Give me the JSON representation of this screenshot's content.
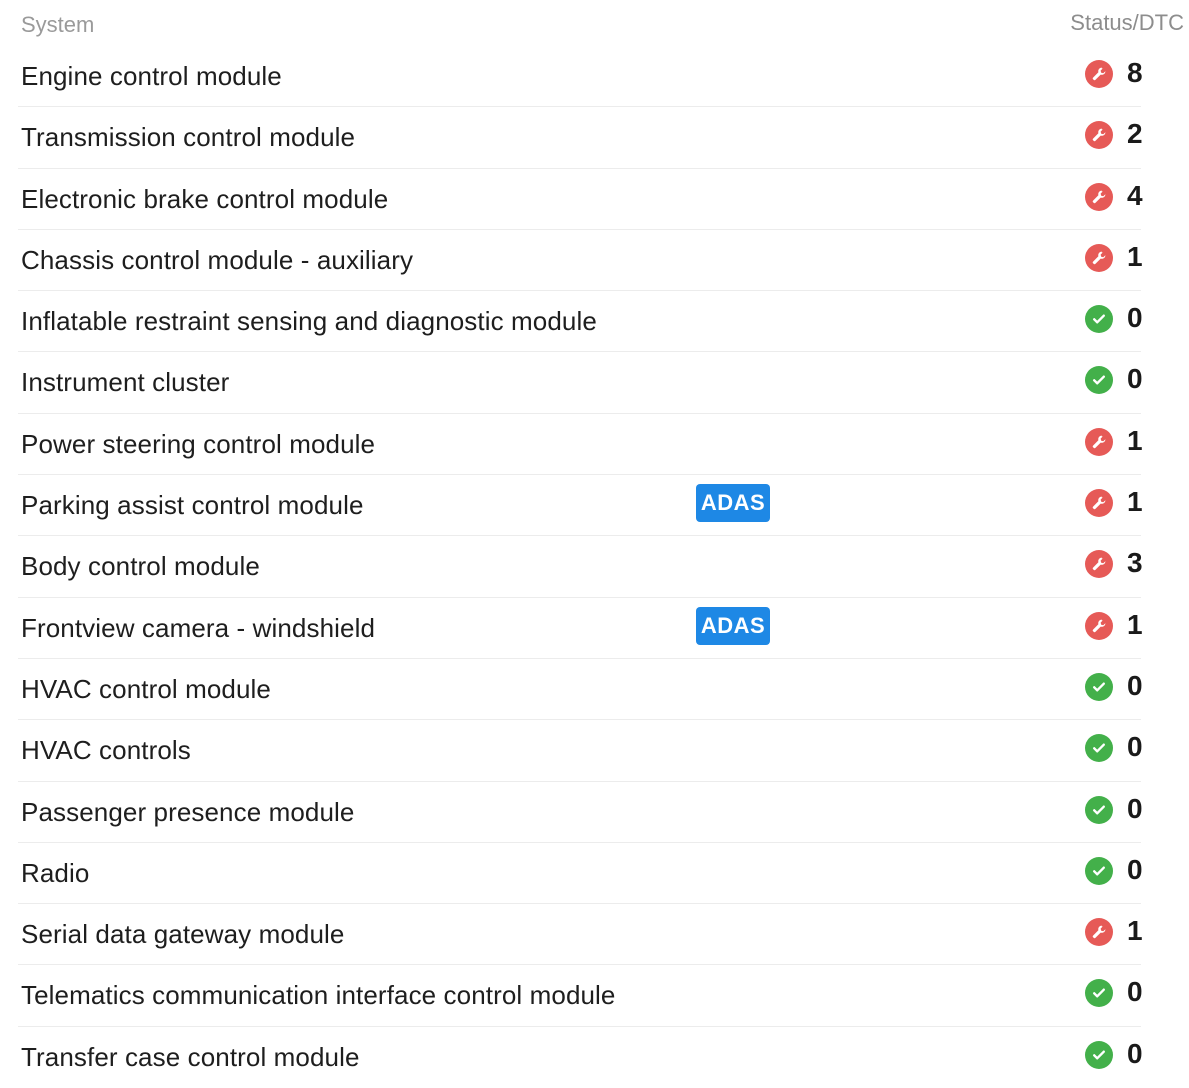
{
  "header": {
    "system_label": "System",
    "status_label": "Status/DTC"
  },
  "colors": {
    "fault": "#e65a57",
    "ok": "#43b04a",
    "adas_badge": "#1e88e5"
  },
  "icons": {
    "fault": "wrench-icon",
    "ok": "check-icon"
  },
  "rows": [
    {
      "name": "Engine control module",
      "badge": "",
      "status": "fault",
      "dtc": "8"
    },
    {
      "name": "Transmission control module",
      "badge": "",
      "status": "fault",
      "dtc": "2"
    },
    {
      "name": "Electronic brake control module",
      "badge": "",
      "status": "fault",
      "dtc": "4"
    },
    {
      "name": "Chassis control module - auxiliary",
      "badge": "",
      "status": "fault",
      "dtc": "1"
    },
    {
      "name": "Inflatable restraint sensing and diagnostic module",
      "badge": "",
      "status": "ok",
      "dtc": "0"
    },
    {
      "name": "Instrument cluster",
      "badge": "",
      "status": "ok",
      "dtc": "0"
    },
    {
      "name": "Power steering control module",
      "badge": "",
      "status": "fault",
      "dtc": "1"
    },
    {
      "name": "Parking assist control module",
      "badge": "ADAS",
      "status": "fault",
      "dtc": "1"
    },
    {
      "name": "Body control module",
      "badge": "",
      "status": "fault",
      "dtc": "3"
    },
    {
      "name": "Frontview camera - windshield",
      "badge": "ADAS",
      "status": "fault",
      "dtc": "1"
    },
    {
      "name": "HVAC control module",
      "badge": "",
      "status": "ok",
      "dtc": "0"
    },
    {
      "name": "HVAC controls",
      "badge": "",
      "status": "ok",
      "dtc": "0"
    },
    {
      "name": "Passenger presence module",
      "badge": "",
      "status": "ok",
      "dtc": "0"
    },
    {
      "name": "Radio",
      "badge": "",
      "status": "ok",
      "dtc": "0"
    },
    {
      "name": "Serial data gateway module",
      "badge": "",
      "status": "fault",
      "dtc": "1"
    },
    {
      "name": "Telematics communication interface control module",
      "badge": "",
      "status": "ok",
      "dtc": "0"
    },
    {
      "name": "Transfer case control module",
      "badge": "",
      "status": "ok",
      "dtc": "0"
    }
  ]
}
